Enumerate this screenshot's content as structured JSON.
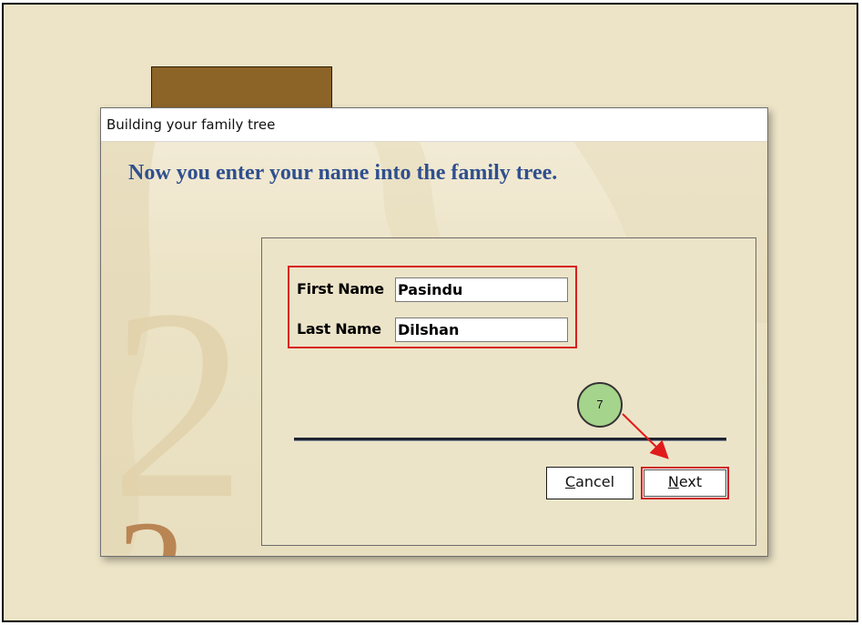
{
  "dialog": {
    "title": "Building your family tree",
    "heading": "Now you enter your name into the family tree.",
    "background_glyph": "2"
  },
  "form": {
    "first_name_label": "First Name",
    "first_name_value": "Pasindu",
    "last_name_label": "Last Name",
    "last_name_value": "Dilshan"
  },
  "buttons": {
    "cancel_prefix": "C",
    "cancel_rest": "ancel",
    "next_prefix": "N",
    "next_rest": "ext"
  },
  "annotation": {
    "step_number": "7"
  },
  "colors": {
    "page_background": "#ede4c7",
    "heading": "#2f4f8f",
    "highlight": "#d82020",
    "step_circle": "#a5d48c",
    "brown_tab": "#8d6428"
  }
}
